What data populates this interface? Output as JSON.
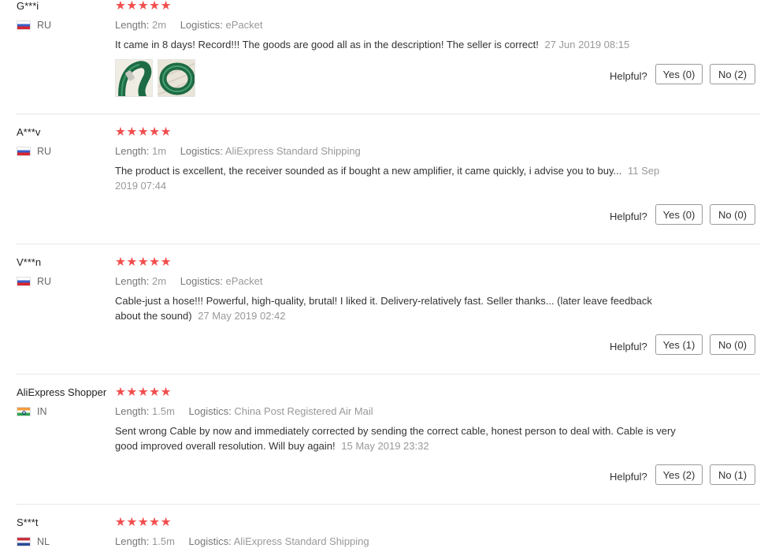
{
  "labels": {
    "length": "Length:",
    "logistics": "Logistics:",
    "helpful": "Helpful?"
  },
  "star_color": "#f24d4d",
  "reviews": [
    {
      "name": "G***i",
      "country": "RU",
      "rating": 5,
      "stars": "★★★★★",
      "length": "2m",
      "logistics": "ePacket",
      "text": "It came in 8 days! Record!!! The goods are good all as in the description! The seller is correct!",
      "time": "27 Jun 2019 08:15",
      "yes": "Yes (0)",
      "no": "No (2)"
    },
    {
      "name": "A***v",
      "country": "RU",
      "rating": 5,
      "stars": "★★★★★",
      "length": "1m",
      "logistics": "AliExpress Standard Shipping",
      "text": "The product is excellent, the receiver sounded as if bought a new amplifier, it came quickly, i advise you to buy...",
      "time": "11 Sep 2019 07:44",
      "yes": "Yes (0)",
      "no": "No (0)"
    },
    {
      "name": "V***n",
      "country": "RU",
      "rating": 5,
      "stars": "★★★★★",
      "length": "2m",
      "logistics": "ePacket",
      "text": "Cable-just a hose!!! Powerful, high-quality, brutal! I liked it. Delivery-relatively fast. Seller thanks... (later leave feedback about the sound)",
      "time": "27 May 2019 02:42",
      "yes": "Yes (1)",
      "no": "No (0)"
    },
    {
      "name": "AliExpress Shopper",
      "country": "IN",
      "rating": 5,
      "stars": "★★★★★",
      "length": "1.5m",
      "logistics": "China Post Registered Air Mail",
      "text": "Sent wrong Cable by now and immediately corrected by sending the correct cable, honest person to deal with. Cable is very good improved overall resolution. Will buy again!",
      "time": "15 May 2019 23:32",
      "yes": "Yes (2)",
      "no": "No (1)"
    },
    {
      "name": "S***t",
      "country": "NL",
      "rating": 5,
      "stars": "★★★★★",
      "length": "1.5m",
      "logistics": "AliExpress Standard Shipping"
    }
  ]
}
